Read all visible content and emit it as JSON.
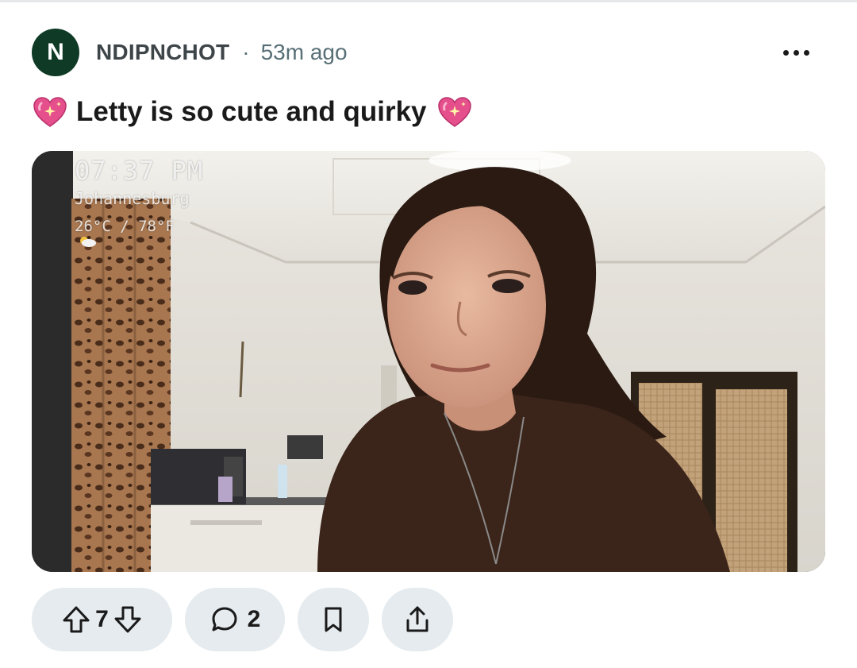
{
  "post": {
    "author_initial": "N",
    "author": "NDIPNCHOT",
    "separator": "·",
    "time_ago": "53m ago",
    "title": "Letty is so cute and quirky",
    "title_emoji_left": "sparkling-heart",
    "title_emoji_right": "sparkling-heart"
  },
  "media": {
    "overlay_time": "07:37 PM",
    "overlay_city": "Johannesburg",
    "overlay_temp": "26°C / 78°F",
    "overlay_weather_icon": "partly-cloudy-icon"
  },
  "actions": {
    "vote_count": "7",
    "comment_count": "2"
  },
  "colors": {
    "avatar_bg": "#0e3a26",
    "pill_bg": "#e5ebee",
    "username": "#3e4549",
    "meta": "#576f76",
    "heart": "#e44f8c"
  }
}
